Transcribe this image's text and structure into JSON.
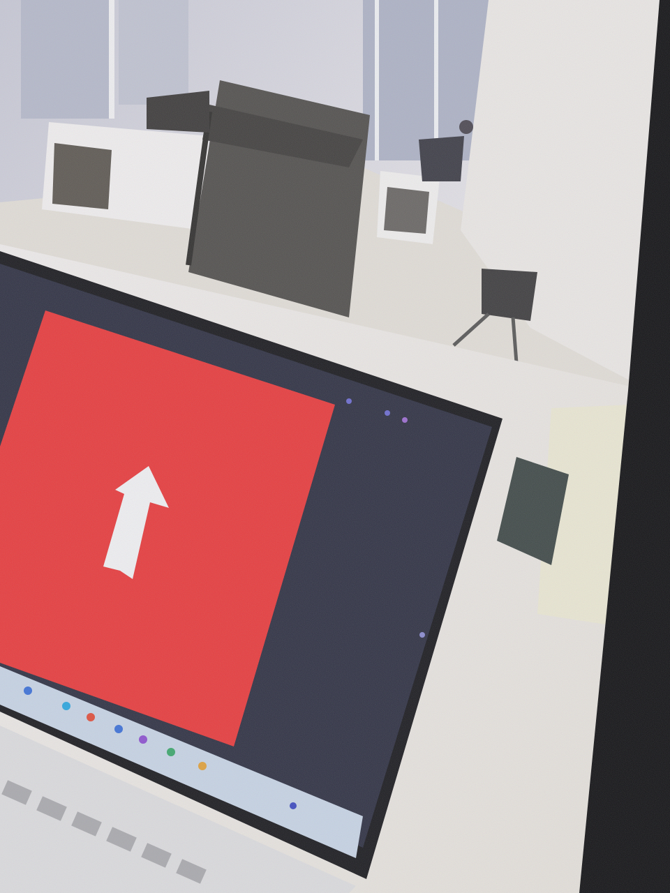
{
  "scene": {
    "subject": "laptop",
    "screen_content": "red-slide-with-up-arrow",
    "arrow_direction": "up"
  },
  "colors": {
    "slide_red": "#e8383a",
    "screen_dark": "#2a2c3f",
    "arrow_white": "#f1f1f4",
    "wall": "#e9e7ec",
    "floor": "#dedad6",
    "window": "#b8bccd",
    "desk": "#ece8e6",
    "mug": "#ece9cf",
    "frame_black": "#0d0d10"
  },
  "icons": {
    "up-arrow": "arrow-up-icon",
    "taskbar": "taskbar-icons"
  }
}
